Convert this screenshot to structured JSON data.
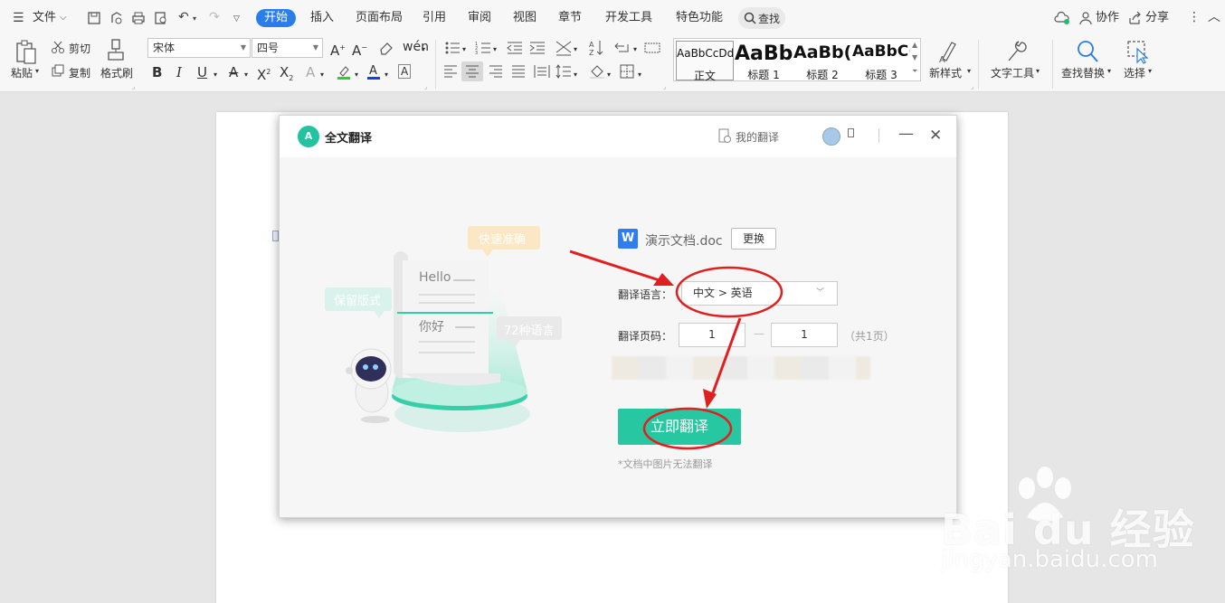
{
  "menubar": {
    "file_label": "文件",
    "tabs": [
      "开始",
      "插入",
      "页面布局",
      "引用",
      "审阅",
      "视图",
      "章节",
      "开发工具",
      "特色功能"
    ],
    "search_label": "查找",
    "collab_label": "协作",
    "share_label": "分享"
  },
  "ribbon": {
    "paste_label": "粘贴",
    "cut_label": "剪切",
    "copy_label": "复制",
    "format_painter_label": "格式刷",
    "font_name": "宋体",
    "font_size": "四号",
    "styles": [
      {
        "preview": "AaBbCcDd",
        "name": "正文"
      },
      {
        "preview": "AaBb",
        "name": "标题 1"
      },
      {
        "preview": "AaBb(",
        "name": "标题 2"
      },
      {
        "preview": "AaBbC(",
        "name": "标题 3"
      }
    ],
    "new_style_label": "新样式",
    "text_tools_label": "文字工具",
    "find_replace_label": "查找替换",
    "select_label": "选择"
  },
  "dialog": {
    "title": "全文翻译",
    "my_translations": "我的翻译",
    "file_name": "演示文档.doc",
    "replace_label": "更换",
    "language_label": "翻译语言：",
    "language_value": "中文 > 英语",
    "pages_label": "翻译页码：",
    "page_from": "1",
    "page_to": "1",
    "page_total": "（共1页）",
    "translate_button": "立即翻译",
    "hint": "*文档中图片无法翻译",
    "illustration": {
      "tag_fast": "快速准确",
      "tag_layout": "保留版式",
      "tag_languages": "72种语言",
      "hello": "Hello",
      "nihao": "你好"
    }
  },
  "watermark": {
    "brand": "Bai du 经验",
    "url": "jingyan.baidu.com"
  },
  "colors": {
    "accent_blue": "#2b7de9",
    "translate_green": "#26c7a1",
    "annotation_red": "#e02020"
  }
}
